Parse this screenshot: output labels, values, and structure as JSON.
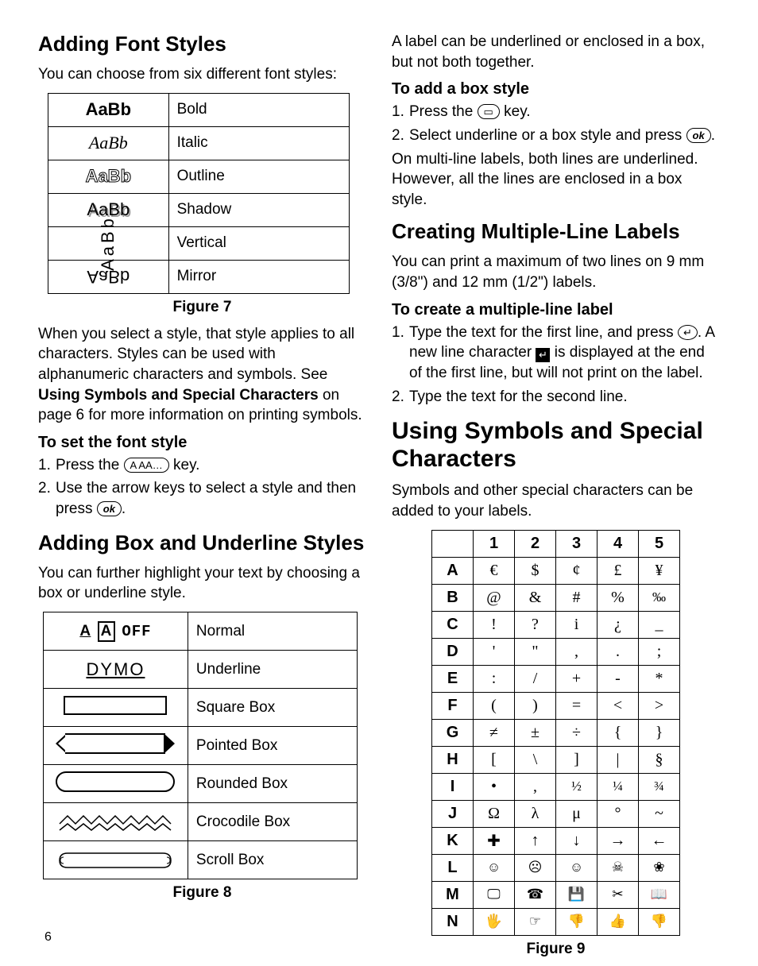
{
  "page_number": "6",
  "left": {
    "h_font_styles": "Adding Font Styles",
    "p_choose": "You can choose from six different font styles:",
    "styles_table": [
      {
        "sample": "AaBb",
        "label": "Bold"
      },
      {
        "sample": "AaBb",
        "label": "Italic"
      },
      {
        "sample": "AaBb",
        "label": "Outline"
      },
      {
        "sample": "AaBb",
        "label": "Shadow"
      },
      {
        "sample": "AaBb",
        "label": "Vertical"
      },
      {
        "sample": "AaBb",
        "label": "Mirror"
      }
    ],
    "fig7": "Figure 7",
    "p_select_a": "When you select a style, that style applies to all characters. Styles can be used with alphanumeric characters and symbols. See ",
    "p_select_link": "Using Symbols and Special Characters",
    "p_select_b": " on page 6 for more information on printing symbols.",
    "sub_set_font": "To set the font style",
    "step1a": "Press the ",
    "step1b": " key.",
    "step2a": "Use the arrow keys to select a style and then press ",
    "step2b": ".",
    "key_style": "A AA…",
    "key_ok": "ok",
    "h_box": "Adding Box and Underline Styles",
    "p_box": "You can further highlight your text by choosing a box or underline style.",
    "box_table": [
      {
        "label": "Normal"
      },
      {
        "label": "Underline"
      },
      {
        "label": "Square Box"
      },
      {
        "label": "Pointed Box"
      },
      {
        "label": "Rounded Box"
      },
      {
        "label": "Crocodile Box"
      },
      {
        "label": "Scroll Box"
      }
    ],
    "normal_sample_a": "A",
    "normal_sample_b": "A",
    "normal_sample_off": "OFF",
    "underline_sample": "DYMO",
    "fig8": "Figure 8"
  },
  "right": {
    "p_label_under": "A label can be underlined or enclosed in a box, but not both together.",
    "sub_add_box": "To add a box style",
    "box_step1a": "Press the ",
    "box_step1b": " key.",
    "box_key": "▭",
    "box_step2a": "Select underline or a box style and press ",
    "box_step2b": ".",
    "p_multiline1": "On multi-line labels, both lines are underlined. However, all the lines are enclosed in a box style.",
    "h_multi": "Creating Multiple-Line Labels",
    "p_multi": "You can print a maximum of two lines on 9 mm (3/8\") and 12 mm (1/2\") labels.",
    "sub_create_multi": "To create a multiple-line label",
    "m_step1a": "Type the text for the first line, and press ",
    "m_step1b": ". A new line character ",
    "m_step1c": " is displayed at the end of the first line, but will not print on the label.",
    "m_step2": "Type the text for the second line.",
    "enter_key": "↵",
    "newline_glyph": "↵",
    "h_symbols": "Using Symbols and Special Characters",
    "p_symbols": "Symbols and other special characters can be added to your labels.",
    "sym_head": [
      "",
      "1",
      "2",
      "3",
      "4",
      "5"
    ],
    "sym_rows": [
      [
        "A",
        "€",
        "$",
        "¢",
        "£",
        "¥"
      ],
      [
        "B",
        "@",
        "&",
        "#",
        "%",
        "‰"
      ],
      [
        "C",
        "!",
        "?",
        "i",
        "¿",
        "_"
      ],
      [
        "D",
        "'",
        "\"",
        ",",
        ".",
        ";"
      ],
      [
        "E",
        ":",
        "/",
        "+",
        "-",
        "*"
      ],
      [
        "F",
        "(",
        ")",
        "=",
        "<",
        ">"
      ],
      [
        "G",
        "≠",
        "±",
        "÷",
        "{",
        "}"
      ],
      [
        "H",
        "[",
        "\\",
        "]",
        "|",
        "§"
      ],
      [
        "I",
        "•",
        ",",
        "½",
        "¼",
        "¾"
      ],
      [
        "J",
        "Ω",
        "λ",
        "μ",
        "°",
        "~"
      ],
      [
        "K",
        "✚",
        "↑",
        "↓",
        "→",
        "←"
      ],
      [
        "L",
        "☺",
        "☹",
        "☺",
        "☠",
        "❀"
      ],
      [
        "M",
        "🖵",
        "☎",
        "💾",
        "✂",
        "📖"
      ],
      [
        "N",
        "🖐",
        "☞",
        "👎",
        "👍",
        "👎"
      ]
    ],
    "fig9": "Figure 9"
  }
}
